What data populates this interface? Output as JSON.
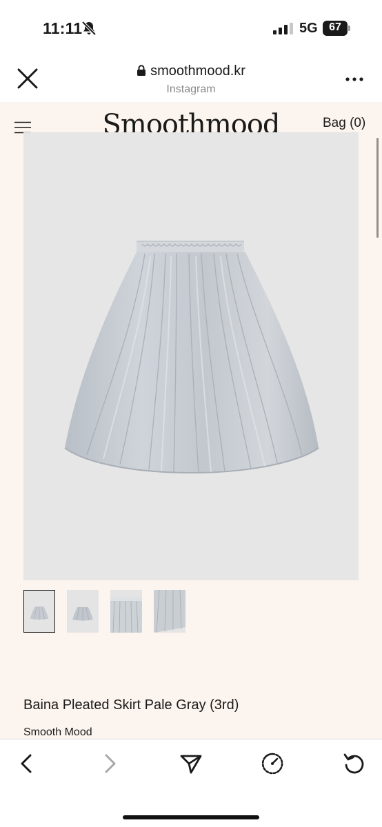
{
  "status_bar": {
    "time": "11:11",
    "network": "5G",
    "battery_level": "67",
    "icons": [
      "bell-slash-icon",
      "signal-icon",
      "battery-icon"
    ]
  },
  "browser": {
    "url": "smoothmood.kr",
    "source": "Instagram",
    "icons": [
      "close-icon",
      "lock-icon",
      "more-icon"
    ]
  },
  "site": {
    "brand": "Smoothmood",
    "bag_label": "Bag (0)",
    "icons": [
      "menu-icon"
    ]
  },
  "product": {
    "title": "Baina Pleated Skirt Pale Gray (3rd)",
    "brand": "Smooth Mood",
    "thumbnail_count": 4,
    "selected_thumbnail": 1,
    "image_color": "#c9ced4"
  },
  "toolbar": {
    "icons": [
      "back-icon",
      "forward-icon",
      "share-icon",
      "speed-icon",
      "reload-icon"
    ]
  },
  "colors": {
    "page_background": "#fcf4ee",
    "image_background": "#e6e6e6",
    "text": "#1a1a1a",
    "muted": "#8a8a8a"
  }
}
